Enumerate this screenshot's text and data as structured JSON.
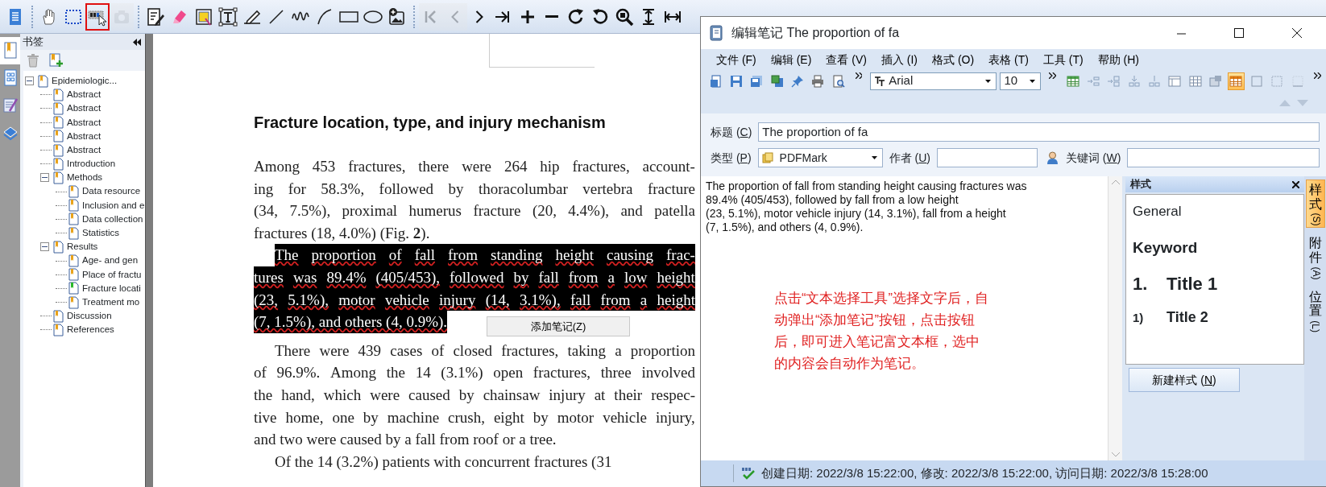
{
  "reader": {
    "toolbar": [
      {
        "selected": false,
        "disabled": false
      },
      {
        "selected": false,
        "disabled": false
      },
      {
        "selected": false,
        "disabled": false
      },
      {
        "selected": true,
        "disabled": false
      },
      {
        "selected": false,
        "disabled": true
      },
      {
        "selected": false,
        "disabled": false
      },
      {
        "selected": false,
        "disabled": false
      },
      {
        "selected": false,
        "disabled": false
      },
      {
        "selected": false,
        "disabled": false
      },
      {
        "selected": false,
        "disabled": false
      },
      {
        "selected": false,
        "disabled": false
      },
      {
        "selected": false,
        "disabled": false
      },
      {
        "selected": false,
        "disabled": false
      },
      {
        "selected": false,
        "disabled": false
      },
      {
        "selected": false,
        "disabled": false
      },
      {
        "selected": false,
        "disabled": false
      },
      {
        "selected": false,
        "disabled": true
      },
      {
        "selected": false,
        "disabled": true
      },
      {
        "selected": false,
        "disabled": false
      },
      {
        "selected": false,
        "disabled": false
      },
      {
        "selected": false,
        "disabled": false
      },
      {
        "selected": false,
        "disabled": false
      },
      {
        "selected": false,
        "disabled": false
      },
      {
        "selected": false,
        "disabled": false
      },
      {
        "selected": false,
        "disabled": false
      },
      {
        "selected": false,
        "disabled": false
      },
      {
        "selected": false,
        "disabled": false
      }
    ],
    "side_tabs": [
      {
        "selected": true
      },
      {
        "selected": false
      },
      {
        "selected": false
      },
      {
        "selected": false
      }
    ],
    "bookmarks": {
      "title": "书签",
      "tree": [
        {
          "label": "Epidemiologic...",
          "selected": false,
          "expanded": true,
          "children": [
            {
              "label": "Abstract",
              "selected": false
            },
            {
              "label": "Abstract",
              "selected": false
            },
            {
              "label": "Abstract",
              "selected": false
            },
            {
              "label": "Abstract",
              "selected": false
            },
            {
              "label": "Abstract",
              "selected": false
            },
            {
              "label": "Introduction",
              "selected": false
            },
            {
              "label": "Methods",
              "selected": false,
              "expanded": true,
              "children": [
                {
                  "label": "Data resource",
                  "selected": false
                },
                {
                  "label": "Inclusion and e",
                  "selected": false
                },
                {
                  "label": "Data collection",
                  "selected": false
                },
                {
                  "label": "Statistics",
                  "selected": false
                }
              ]
            },
            {
              "label": "Results",
              "selected": false,
              "expanded": true,
              "children": [
                {
                  "label": "Age- and gen",
                  "selected": false
                },
                {
                  "label": "Place of fractu",
                  "selected": false
                },
                {
                  "label": "Fracture locati",
                  "selected": true
                },
                {
                  "label": "Treatment mo",
                  "selected": false
                }
              ]
            },
            {
              "label": "Discussion",
              "selected": false
            },
            {
              "label": "References",
              "selected": false
            }
          ]
        }
      ]
    },
    "document": {
      "heading": "Fracture location, type, and injury mechanism",
      "paragraphs": [
        {
          "indented": false,
          "selected": false,
          "lines": [
            "Among 453 fractures, there were 264 hip fractures, account-",
            "ing for 58.3%, followed by thoracolumbar vertebra fracture",
            "(34, 7.5%), proximal humerus fracture (20, 4.4%), and patella",
            "fractures (18, 4.0%) (Fig. **2**)."
          ]
        },
        {
          "indented": true,
          "selected": true,
          "lines": [
            "The proportion of fall from standing height causing frac-",
            "tures was 89.4% (405/453), followed by fall from a low height",
            "(23, 5.1%), motor vehicle injury (14, 3.1%), fall from a height",
            "(7, 1.5%), and others (4, 0.9%)."
          ]
        },
        {
          "indented": true,
          "selected": false,
          "lines": [
            "There were 439 cases of closed fractures, taking a proportion",
            "of 96.9%. Among the 14 (3.1%) open fractures, three involved",
            "the hand, which were caused by chainsaw injury at their respec-",
            "tive home, one by machine crush, eight by motor vehicle injury,",
            "and two were caused by a fall from roof or a tree."
          ]
        },
        {
          "indented": true,
          "selected": false,
          "lines": [
            "Of the 14 (3.2%) patients with concurrent fractures (31"
          ]
        }
      ],
      "popup_button": "添加笔记(Z)"
    }
  },
  "note_window": {
    "title": "编辑笔记 The proportion of fa",
    "menu": [
      "文件 (F)",
      "编辑 (E)",
      "查看 (V)",
      "插入 (I)",
      "格式 (O)",
      "表格 (T)",
      "工具 (T)",
      "帮助 (H)"
    ],
    "font": "Arial",
    "font_size": "10",
    "toolbar": [
      {
        "selected": false
      },
      {
        "selected": false
      },
      {
        "selected": false
      },
      {
        "selected": false
      },
      {
        "selected": false
      },
      {
        "selected": false
      },
      {
        "selected": false
      },
      {
        "selected": false
      },
      {
        "selected": true
      },
      {
        "selected": false
      },
      {
        "selected": false
      },
      {
        "selected": false
      }
    ],
    "title_field": {
      "label": "标题 (",
      "key": "C",
      "after": ")",
      "value": "The proportion of fa"
    },
    "type_field": {
      "label": "类型 (",
      "key": "P",
      "after": ")",
      "value": "PDFMark"
    },
    "author_field": {
      "label": "作者 (",
      "key": "U",
      "after": ")"
    },
    "keywords_field": {
      "label": "关键词 (",
      "key": "W",
      "after": ")"
    },
    "note_text": "The proportion of fall from standing height causing fractures was\n89.4% (405/453), followed by fall from a low height\n(23, 5.1%), motor vehicle injury (14, 3.1%), fall from a height\n(7, 1.5%), and others (4, 0.9%).",
    "annotation": "点击“文本选择工具”选择文字后，自动弹出“添加笔记”按钮，点击按钮后，即可进入笔记富文本框，选中的内容会自动作为笔记。",
    "styles_panel": {
      "title": "样式",
      "styles": [
        {
          "kind": "plain",
          "text": "General"
        },
        {
          "kind": "keyword",
          "text": "Keyword"
        },
        {
          "kind": "heading1",
          "number": "1.",
          "text": "Title 1"
        },
        {
          "kind": "heading2",
          "number": "1)",
          "text": "Title 2"
        }
      ],
      "new_button": {
        "label": "新建样式 (",
        "key": "N",
        "after": ")"
      }
    },
    "side_tabs": [
      {
        "label": "样式",
        "key": "(S)",
        "selected": true
      },
      {
        "label": "附件",
        "key": "(A)",
        "selected": false
      },
      {
        "label": "位置",
        "key": "(L)",
        "selected": false
      }
    ],
    "status": "创建日期: 2022/3/8 15:22:00, 修改: 2022/3/8 15:22:00, 访问日期: 2022/3/8 15:28:00"
  }
}
